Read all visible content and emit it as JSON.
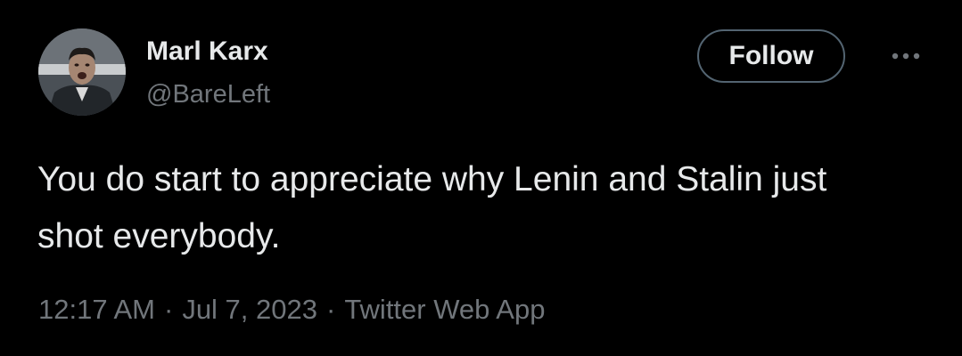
{
  "author": {
    "display_name": "Marl Karx",
    "handle": "@BareLeft",
    "avatar_icon": "profile-photo"
  },
  "actions": {
    "follow_label": "Follow",
    "more_icon": "ellipsis-icon"
  },
  "tweet": {
    "text_lines": [
      "You do start to appreciate why Lenin and Stalin just",
      "shot everybody."
    ],
    "time": "12:17 AM",
    "separator": "·",
    "date": "Jul 7, 2023",
    "source": "Twitter Web App"
  },
  "colors": {
    "background": "#000000",
    "primary_text": "#e7e9ea",
    "secondary_text": "#71767b",
    "button_border": "#536471"
  }
}
